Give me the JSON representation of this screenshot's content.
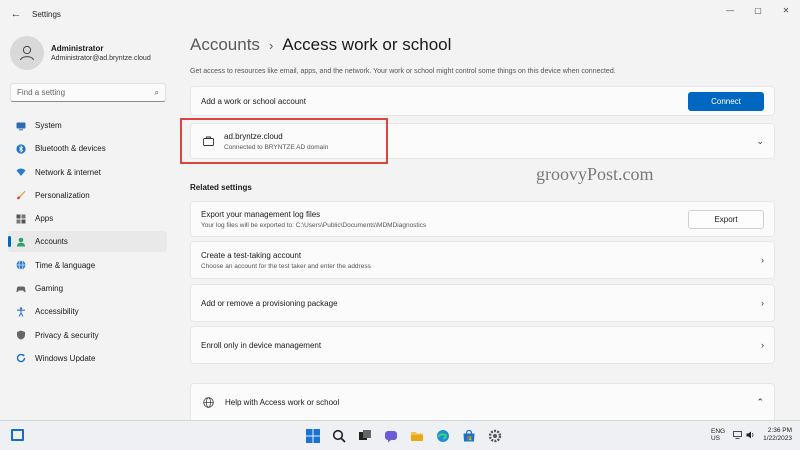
{
  "window": {
    "title": "Settings",
    "back_icon": "arrow-left-icon",
    "minimize": "—",
    "maximize": "▢",
    "close": "✕"
  },
  "profile": {
    "name": "Administrator",
    "email": "Administrator@ad.bryntze.cloud"
  },
  "search": {
    "placeholder": "Find a setting",
    "icon": "search-icon"
  },
  "nav": {
    "items": [
      {
        "label": "System",
        "icon": "monitor-icon",
        "color": "#2d6cb5"
      },
      {
        "label": "Bluetooth & devices",
        "icon": "bluetooth-icon",
        "color": "#1f73c7"
      },
      {
        "label": "Network & internet",
        "icon": "wifi-icon",
        "color": "#2a7bd0"
      },
      {
        "label": "Personalization",
        "icon": "brush-icon",
        "color": "#d08a2a"
      },
      {
        "label": "Apps",
        "icon": "apps-icon",
        "color": "#555555"
      },
      {
        "label": "Accounts",
        "icon": "person-icon",
        "color": "#2ba36a",
        "active": true
      },
      {
        "label": "Time & language",
        "icon": "globe-icon",
        "color": "#2a7bd0"
      },
      {
        "label": "Gaming",
        "icon": "gamepad-icon",
        "color": "#666666"
      },
      {
        "label": "Accessibility",
        "icon": "accessibility-icon",
        "color": "#2a7bd0"
      },
      {
        "label": "Privacy & security",
        "icon": "shield-icon",
        "color": "#666666"
      },
      {
        "label": "Windows Update",
        "icon": "update-icon",
        "color": "#1f73c7"
      }
    ]
  },
  "main": {
    "breadcrumb_parent": "Accounts",
    "breadcrumb_sep": "›",
    "page_title": "Access work or school",
    "description": "Get access to resources like email, apps, and the network. Your work or school might control some things on this device when connected.",
    "add_account": {
      "label": "Add a work or school account",
      "button": "Connect"
    },
    "connected_account": {
      "name": "ad.bryntze.cloud",
      "status": "Connected to BRYNTZE AD domain",
      "icon": "briefcase-icon"
    },
    "related_title": "Related settings",
    "export_logs": {
      "label": "Export your management log files",
      "sub": "Your log files will be exported to: C:\\Users\\Public\\Documents\\MDMDiagnostics",
      "button": "Export"
    },
    "test_account": {
      "label": "Create a test-taking account",
      "sub": "Choose an account for the test taker and enter the address"
    },
    "provisioning": {
      "label": "Add or remove a provisioning package"
    },
    "enroll": {
      "label": "Enroll only in device management"
    },
    "help": {
      "label": "Help with Access work or school",
      "icon": "globe-icon"
    }
  },
  "watermark": "groovyPost.com",
  "colors": {
    "accent": "#0067c0",
    "highlight": "#d9463f"
  },
  "taskbar": {
    "icons": [
      "windows-start-icon",
      "search-icon",
      "task-view-icon",
      "chat-icon",
      "file-explorer-icon",
      "edge-icon",
      "store-icon",
      "settings-icon"
    ],
    "tray": {
      "lang_1": "ENG",
      "lang_2": "US",
      "time": "2:36 PM",
      "date": "1/22/2023"
    }
  }
}
